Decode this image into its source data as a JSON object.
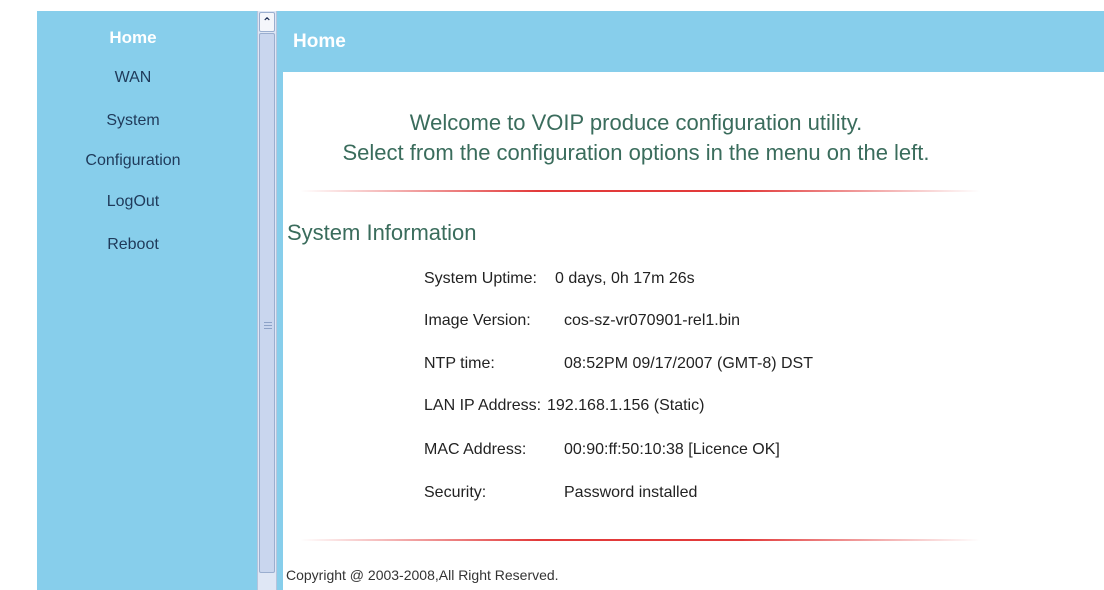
{
  "sidebar": {
    "items": [
      {
        "label": "Home",
        "active": true
      },
      {
        "label": "WAN"
      },
      {
        "label": "System"
      },
      {
        "label": "Configuration"
      },
      {
        "label": "LogOut"
      },
      {
        "label": "Reboot"
      }
    ]
  },
  "header": {
    "title": "Home"
  },
  "welcome": {
    "line1": "Welcome to VOIP produce configuration utility.",
    "line2": "Select from the configuration options in the menu on the left."
  },
  "system_info": {
    "title": "System Information",
    "rows": [
      {
        "label": "System Uptime:",
        "value": "0 days, 0h 17m 26s"
      },
      {
        "label": "Image Version:",
        "value": "cos-sz-vr070901-rel1.bin"
      },
      {
        "label": "NTP time:",
        "value": "08:52PM 09/17/2007 (GMT-8) DST"
      },
      {
        "label": "LAN IP Address:",
        "value": "192.168.1.156 (Static)"
      },
      {
        "label": "MAC Address:",
        "value": "00:90:ff:50:10:38 [Licence OK]"
      },
      {
        "label": "Security:",
        "value": "Password installed"
      }
    ]
  },
  "footer": {
    "copyright": "Copyright @ 2003-2008,All Right Reserved."
  },
  "colors": {
    "frame_blue": "#87ceeb",
    "heading_green": "#3a6c5c",
    "divider_red": "#e23a3a"
  }
}
